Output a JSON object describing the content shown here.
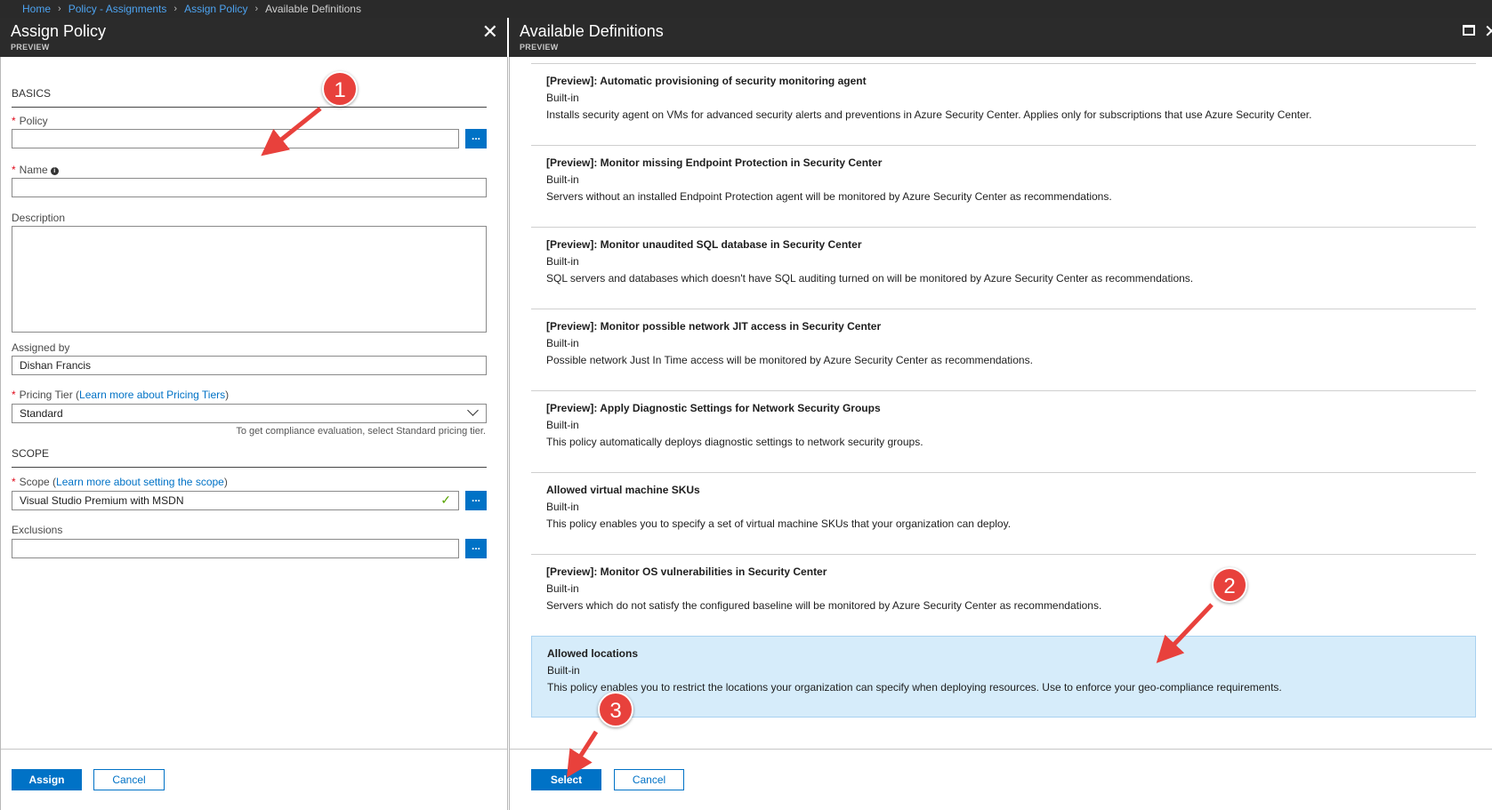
{
  "breadcrumb": {
    "items": [
      "Home",
      "Policy - Assignments",
      "Assign Policy"
    ],
    "current": "Available Definitions"
  },
  "left_blade": {
    "title": "Assign Policy",
    "subtitle": "PREVIEW",
    "basics_heading": "BASICS",
    "policy_label": "Policy",
    "policy_value": "",
    "name_label": "Name",
    "name_value": "",
    "description_label": "Description",
    "assigned_by_label": "Assigned by",
    "assigned_by_value": "Dishan Francis",
    "pricing_tier_label": "Pricing Tier",
    "pricing_tier_link": "Learn more about Pricing Tiers",
    "pricing_tier_value": "Standard",
    "pricing_hint": "To get compliance evaluation, select Standard pricing tier.",
    "scope_heading": "SCOPE",
    "scope_label": "Scope",
    "scope_link": "Learn more about setting the scope",
    "scope_value": "Visual Studio Premium with MSDN",
    "exclusions_label": "Exclusions",
    "exclusions_value": "",
    "browse_label": "...",
    "assign_button": "Assign",
    "cancel_button": "Cancel"
  },
  "right_blade": {
    "title": "Available Definitions",
    "subtitle": "PREVIEW",
    "definitions": [
      {
        "title": "[Preview]: Automatic provisioning of security monitoring agent",
        "type": "Built-in",
        "description": "Installs security agent on VMs for advanced security alerts and preventions in Azure Security Center. Applies only for subscriptions that use Azure Security Center."
      },
      {
        "title": "[Preview]: Monitor missing Endpoint Protection in Security Center",
        "type": "Built-in",
        "description": "Servers without an installed Endpoint Protection agent will be monitored by Azure Security Center as recommendations."
      },
      {
        "title": "[Preview]: Monitor unaudited SQL database in Security Center",
        "type": "Built-in",
        "description": "SQL servers and databases which doesn't have SQL auditing turned on will be monitored by Azure Security Center as recommendations."
      },
      {
        "title": "[Preview]: Monitor possible network JIT access in Security Center",
        "type": "Built-in",
        "description": "Possible network Just In Time access will be monitored by Azure Security Center as recommendations."
      },
      {
        "title": "[Preview]: Apply Diagnostic Settings for Network Security Groups",
        "type": "Built-in",
        "description": "This policy automatically deploys diagnostic settings to network security groups."
      },
      {
        "title": "Allowed virtual machine SKUs",
        "type": "Built-in",
        "description": "This policy enables you to specify a set of virtual machine SKUs that your organization can deploy."
      },
      {
        "title": "[Preview]: Monitor OS vulnerabilities in Security Center",
        "type": "Built-in",
        "description": "Servers which do not satisfy the configured baseline will be monitored by Azure Security Center as recommendations."
      },
      {
        "title": "Allowed locations",
        "type": "Built-in",
        "description": "This policy enables you to restrict the locations your organization can specify when deploying resources. Use to enforce your geo-compliance requirements."
      }
    ],
    "selected_index": 7,
    "select_button": "Select",
    "cancel_button": "Cancel"
  },
  "annotations": {
    "badges": [
      "1",
      "2",
      "3"
    ],
    "color": "#e8413c"
  },
  "colors": {
    "accent": "#0072c6",
    "header_bg": "#2b2b2b",
    "selected_bg": "#d6ecfa",
    "required": "#e00b1c"
  }
}
